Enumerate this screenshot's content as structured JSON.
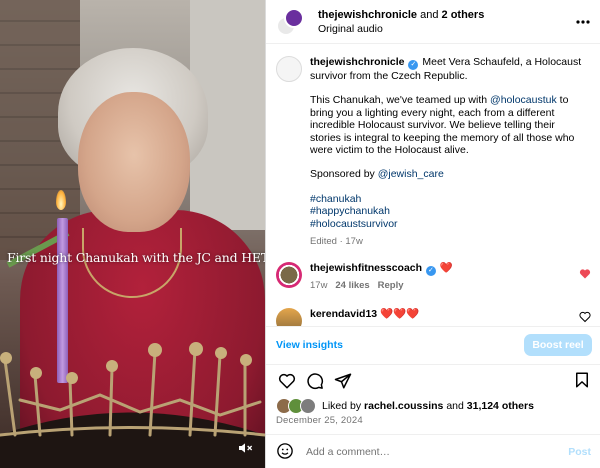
{
  "video": {
    "caption_overlay": "First night Chanukah with the JC and HET",
    "icons": {
      "mute": "speaker-muted-icon"
    }
  },
  "header": {
    "username": "thejewishchronicle",
    "and_text": "and",
    "others": "2 others",
    "audio": "Original audio",
    "more_icon": "more-horizontal-icon"
  },
  "post": {
    "username": "thejewishchronicle",
    "intro": "Meet Vera Schaufeld, a Holocaust survivor from the Czech Republic.",
    "para1_before": "This Chanukah, we've teamed up with",
    "para1_mention": "@holocaustuk",
    "para1_after": "to bring you a lighting every night, each from a different incredible Holocaust survivor. We believe telling their stories is integral to keeping the memory of all those who were victim to the Holocaust alive.",
    "sponsor_before": "Sponsored by",
    "sponsor_mention": "@jewish_care",
    "hashtags": [
      "#chanukah",
      "#happychanukah",
      "#holocaustsurvivor"
    ],
    "meta": "Edited · 17w"
  },
  "comments": [
    {
      "username": "thejewishfitnesscoach",
      "text": "❤️",
      "time": "17w",
      "likes": "24 likes",
      "reply": "Reply"
    },
    {
      "username": "kerendavid13",
      "text": "❤️❤️❤️",
      "time": "",
      "likes": "",
      "reply": ""
    }
  ],
  "insights": {
    "view": "View insights",
    "boost": "Boost reel"
  },
  "actions": {
    "icons": [
      "heart-icon",
      "comment-icon",
      "share-icon",
      "bookmark-icon"
    ]
  },
  "likes": {
    "prefix": "Liked by",
    "user": "rachel.coussins",
    "middle": "and",
    "count": "31,124 others"
  },
  "date": "December 25, 2024",
  "comment_box": {
    "placeholder": "Add a comment…",
    "post": "Post",
    "emoji_icon": "emoji-icon"
  },
  "colors": {
    "link": "#00376b",
    "accent": "#0095f6",
    "boost_bg": "#b2dffc",
    "heart": "#ed4956"
  }
}
